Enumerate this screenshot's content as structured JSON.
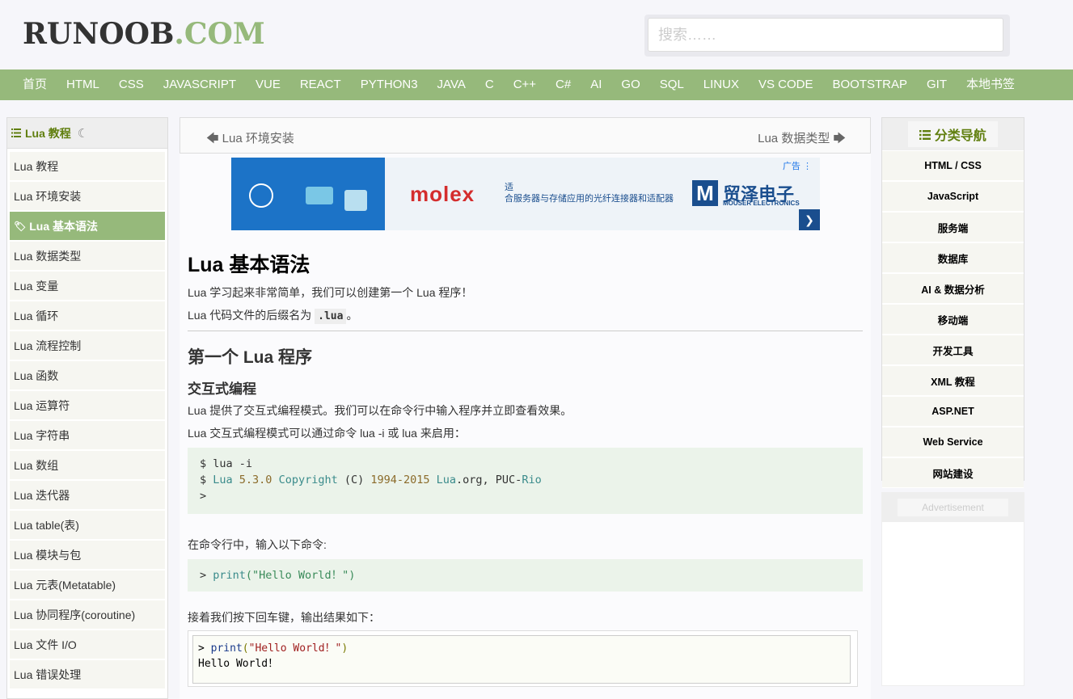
{
  "header": {
    "logo_part1": "RUNOOB",
    "logo_part2": ".COM",
    "search_placeholder": "搜索……"
  },
  "nav": [
    "首页",
    "HTML",
    "CSS",
    "JAVASCRIPT",
    "VUE",
    "REACT",
    "PYTHON3",
    "JAVA",
    "C",
    "C++",
    "C#",
    "AI",
    "GO",
    "SQL",
    "LINUX",
    "VS CODE",
    "BOOTSTRAP",
    "GIT",
    "本地书签"
  ],
  "left_sidebar": {
    "title": "Lua 教程",
    "items": [
      {
        "label": "Lua 教程",
        "active": false
      },
      {
        "label": "Lua 环境安装",
        "active": false
      },
      {
        "label": "Lua 基本语法",
        "active": true
      },
      {
        "label": "Lua 数据类型",
        "active": false
      },
      {
        "label": "Lua 变量",
        "active": false
      },
      {
        "label": "Lua 循环",
        "active": false
      },
      {
        "label": "Lua 流程控制",
        "active": false
      },
      {
        "label": "Lua 函数",
        "active": false
      },
      {
        "label": "Lua 运算符",
        "active": false
      },
      {
        "label": "Lua 字符串",
        "active": false
      },
      {
        "label": "Lua 数组",
        "active": false
      },
      {
        "label": "Lua 迭代器",
        "active": false
      },
      {
        "label": "Lua table(表)",
        "active": false
      },
      {
        "label": "Lua 模块与包",
        "active": false
      },
      {
        "label": "Lua 元表(Metatable)",
        "active": false
      },
      {
        "label": "Lua 协同程序(coroutine)",
        "active": false
      },
      {
        "label": "Lua 文件 I/O",
        "active": false
      },
      {
        "label": "Lua 错误处理",
        "active": false
      }
    ]
  },
  "pager": {
    "prev": "Lua 环境安装",
    "next": "Lua 数据类型"
  },
  "ad": {
    "label": "广告",
    "brand_left": "molex",
    "text1": "适",
    "text2": "合服务器与存储应用的光纤连接器和适配器",
    "logo_letter": "M",
    "brand_right": "贸泽电子",
    "brand_right_sub": "MOUSER ELECTRONICS"
  },
  "article": {
    "title": "Lua 基本语法",
    "p1": "Lua 学习起来非常简单，我们可以创建第一个 Lua 程序！",
    "p2_pre": "Lua 代码文件的后缀名为 ",
    "p2_code": ".lua",
    "p2_post": "。",
    "h2": "第一个 Lua 程序",
    "h3": "交互式编程",
    "p3": "Lua 提供了交互式编程模式。我们可以在命令行中输入程序并立即查看效果。",
    "p4": "Lua 交互式编程模式可以通过命令 lua -i 或 lua 来启用：",
    "code1_line1": "$ lua -i",
    "code1_l2_a": "$ ",
    "code1_l2_b": "Lua",
    "code1_l2_c": " 5.3",
    "code1_l2_d": ".0",
    "code1_l2_e": "  Copyright",
    "code1_l2_f": " (C) ",
    "code1_l2_g": "1994-2015",
    "code1_l2_h": " Lua",
    "code1_l2_i": ".org, PUC-",
    "code1_l2_j": "Rio",
    "code1_line3": ">",
    "p5": "在命令行中，输入以下命令:",
    "code2_a": "> ",
    "code2_b": "print",
    "code2_c": "(\"Hello World！\")",
    "p6": "接着我们按下回车键，输出结果如下：",
    "code3_a": "> ",
    "code3_b": "print",
    "code3_c": "(",
    "code3_d": "\"Hello World！\"",
    "code3_e": ")",
    "code3_line2": "Hello World！"
  },
  "right_sidebar": {
    "title": "分类导航",
    "items": [
      "HTML / CSS",
      "JavaScript",
      "服务端",
      "数据库",
      "AI & 数据分析",
      "移动端",
      "开发工具",
      "XML 教程",
      "ASP.NET",
      "Web Service",
      "网站建设"
    ],
    "ad_label": "Advertisement"
  },
  "colors": {
    "accent": "#96b97b",
    "accent_text": "#617f10",
    "code_bg": "#ebf3ea"
  }
}
